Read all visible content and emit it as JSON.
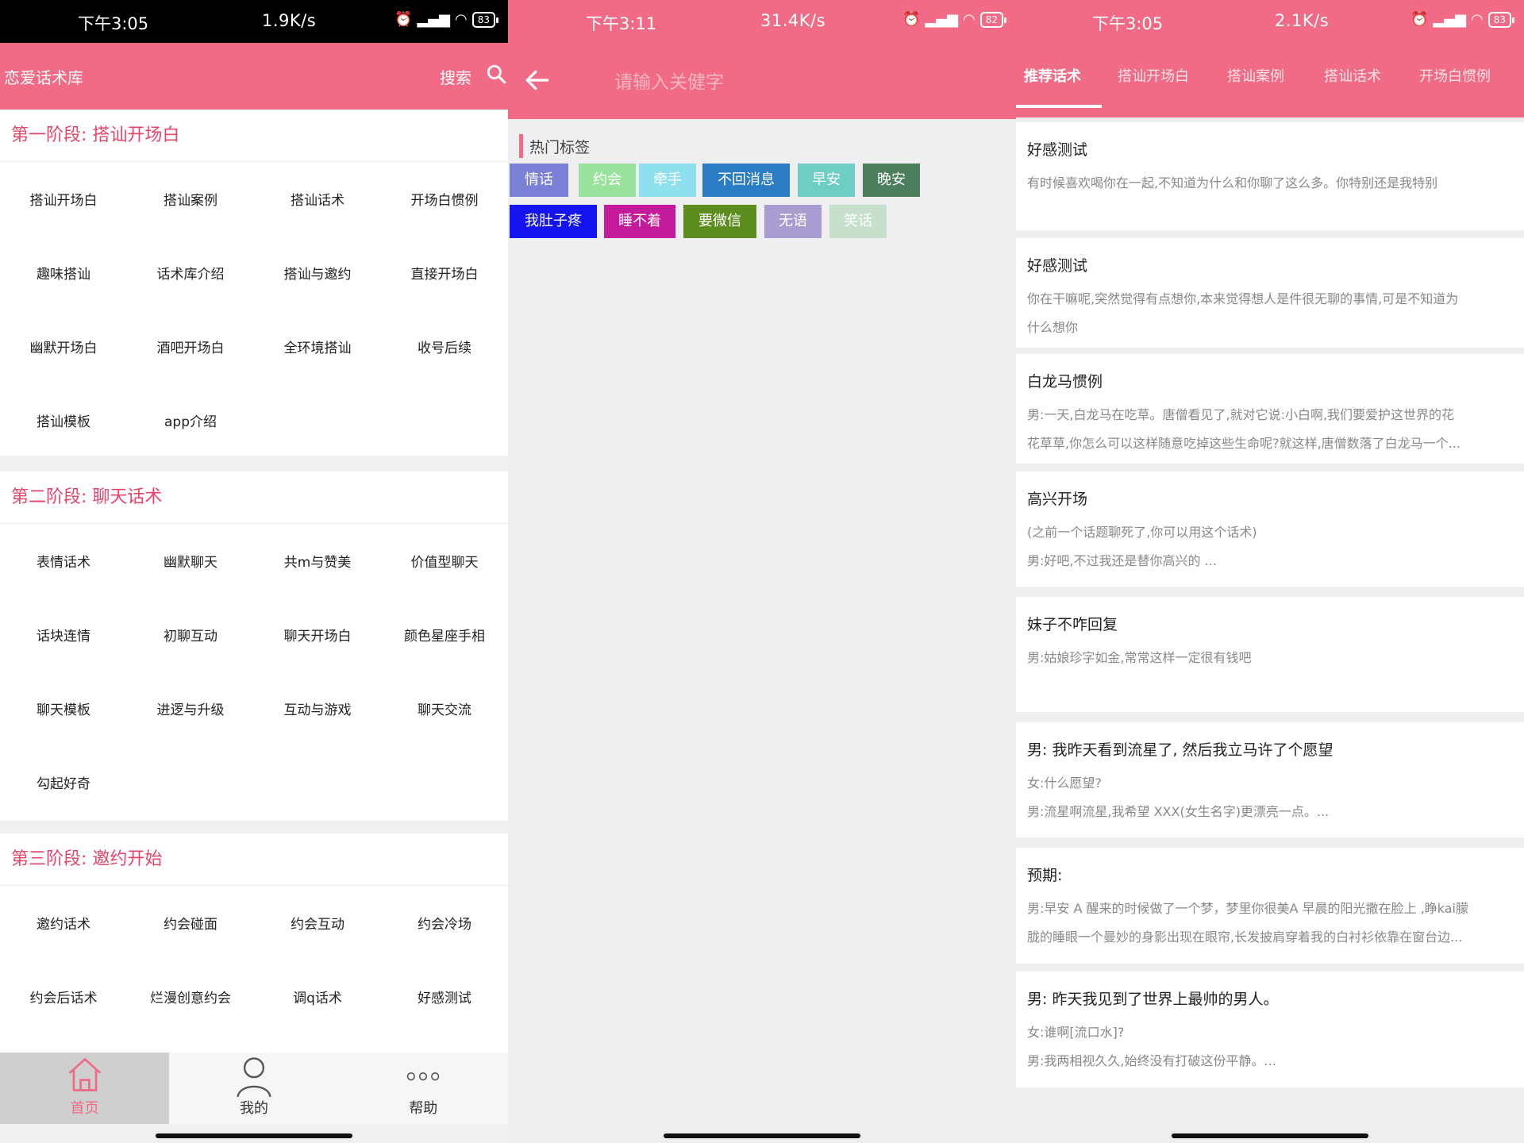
{
  "status_bars": [
    {
      "time": "下午3:05",
      "net": "1.9K/s",
      "battery": "83"
    },
    {
      "time": "下午3:11",
      "net": "31.4K/s",
      "battery": "82"
    },
    {
      "time": "下午3:05",
      "net": "2.1K/s",
      "battery": "83"
    }
  ],
  "colors": {
    "accent": "#f26b86",
    "section_title": "#e84468"
  },
  "home": {
    "title": "恋爱话术库",
    "search_label": "搜索",
    "sections": [
      {
        "title": "第一阶段: 搭讪开场白",
        "items": [
          "搭讪开场白",
          "搭讪案例",
          "搭讪话术",
          "开场白惯例",
          "趣味搭讪",
          "话术库介绍",
          "搭讪与邀约",
          "直接开场白",
          "幽默开场白",
          "酒吧开场白",
          "全环境搭讪",
          "收号后续",
          "搭讪模板",
          "app介绍"
        ]
      },
      {
        "title": "第二阶段: 聊天话术",
        "items": [
          "表情话术",
          "幽默聊天",
          "共m与赞美",
          "价值型聊天",
          "话块连情",
          "初聊互动",
          "聊天开场白",
          "颜色星座手相",
          "聊天模板",
          "进逻与升级",
          "互动与游戏",
          "聊天交流",
          "勾起好奇"
        ]
      },
      {
        "title": "第三阶段: 邀约开始",
        "items": [
          "邀约话术",
          "约会碰面",
          "约会互动",
          "约会冷场",
          "约会后话术",
          "烂漫创意约会",
          "调q话术",
          "好感测试"
        ]
      }
    ],
    "tabbar": [
      {
        "label": "首页",
        "icon": "home-icon",
        "active": true
      },
      {
        "label": "我的",
        "icon": "user-icon",
        "active": false
      },
      {
        "label": "帮助",
        "icon": "more-dots-icon",
        "active": false
      }
    ]
  },
  "search": {
    "placeholder": "请输入关健字",
    "hot_title": "热门标签",
    "tags": [
      {
        "label": "情话",
        "color": "#7b7fd6"
      },
      {
        "label": "约会",
        "color": "#99e39c"
      },
      {
        "label": "牵手",
        "color": "#8fe0ef"
      },
      {
        "label": "不回消息",
        "color": "#2a7cc5"
      },
      {
        "label": "早安",
        "color": "#6ecdc4"
      },
      {
        "label": "晚安",
        "color": "#4a7e5c"
      },
      {
        "label": "我肚子疼",
        "color": "#1414f0"
      },
      {
        "label": "睡不着",
        "color": "#c51a9a"
      },
      {
        "label": "要微信",
        "color": "#5e8d1f"
      },
      {
        "label": "无语",
        "color": "#a99cd0"
      },
      {
        "label": "笑话",
        "color": "#c6e0cc"
      }
    ]
  },
  "recommend": {
    "tabs": [
      "推荐话术",
      "搭讪开场白",
      "搭讪案例",
      "搭讪话术",
      "开场白惯例"
    ],
    "cards": [
      {
        "title": "好感测试",
        "lines": [
          "有时候喜欢喝你在一起,不知道为什么和你聊了这么多。你特别还是我特别"
        ]
      },
      {
        "title": "好感测试",
        "lines": [
          "你在干嘛呢,突然觉得有点想你,本来觉得想人是件很无聊的事情,可是不知道为",
          "什么想你"
        ]
      },
      {
        "title": "白龙马惯例",
        "lines": [
          "男:一天,白龙马在吃草。唐僧看见了,就对它说:小白啊,我们要爱护这世界的花",
          "花草草,你怎么可以这样随意吃掉这些生命呢?就这样,唐僧数落了白龙马一个..."
        ]
      },
      {
        "title": "高兴开场",
        "lines": [
          "(之前一个话题聊死了,你可以用这个话术)",
          "男:好吧,不过我还是替你高兴的 ..."
        ]
      },
      {
        "title": "妹子不咋回复",
        "lines": [
          "男:姑娘珍字如金,常常这样一定很有钱吧"
        ]
      },
      {
        "title": "男: 我昨天看到流星了, 然后我立马许了个愿望",
        "lines": [
          "女:什么愿望?",
          "男:流星啊流星,我希望 XXX(女生名字)更漂亮一点。..."
        ]
      },
      {
        "title": "预期:",
        "lines": [
          "男:早安 A 醒来的时候做了一个梦，梦里你很美A 早晨的阳光撒在脸上 ,睁kai朦",
          "胧的睡眼一个曼妙的身影出现在眼帘,长发披肩穿着我的白衬衫依靠在窗台边..."
        ]
      },
      {
        "title": "男: 昨天我见到了世界上最帅的男人。",
        "lines": [
          "女:谁啊[流口水]?",
          "男:我两相视久久,始终没有打破这份平静。..."
        ]
      }
    ]
  }
}
